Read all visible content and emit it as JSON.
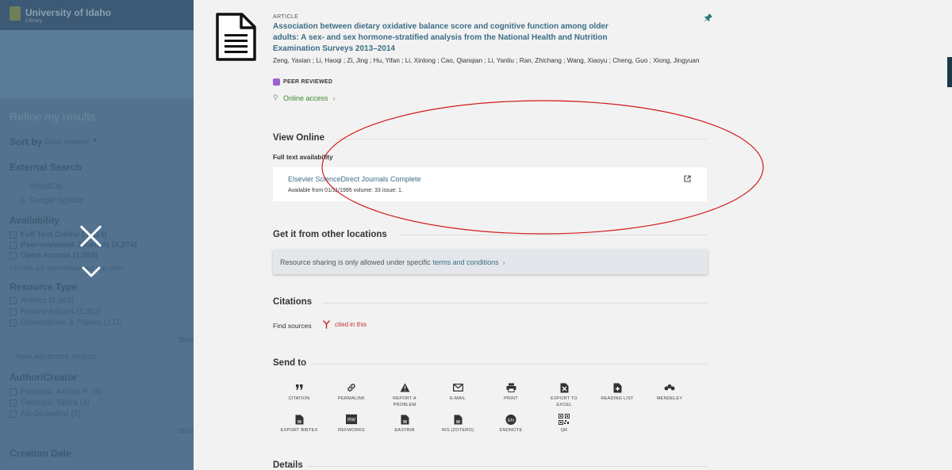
{
  "background": {
    "logo": "University of Idaho",
    "logo_sub": "Library",
    "refine_heading": "Refine my results",
    "sort_by": "Sort by",
    "sort_value": "Date newest",
    "external_search": "External Search",
    "ext_items": [
      "WorldCat",
      "Google Scholar"
    ],
    "availability": "Availability",
    "avail_items": [
      "Full Text Online (3,614)",
      "Peer-reviewed Journals (4,274)",
      "Open Access (1,089)"
    ],
    "avail_note": "* Counts are approximate and may differ",
    "resource_type": "Resource Type",
    "type_items": [
      "Articles (5,461)",
      "Review Articles (1,302)",
      "Dissertations & Theses (171)"
    ],
    "show_more": "Show more",
    "new_search": "New Advanced Search",
    "author_creator": "Author/Creator",
    "author_items": [
      "Farooqui, Akhlaq R. (4)",
      "Farooqui, Tahira (4)",
      "Alli-Oluwafuyi (2)"
    ],
    "creation_date": "Creation Date"
  },
  "article": {
    "type": "Article",
    "title": "Association between dietary oxidative balance score and cognitive function among older adults: A sex- and sex hormone-stratified analysis from the National Health and Nutrition Examination Surveys 2013–2014",
    "authors": "Zeng, Yaxian ; Li, Haoqi ; Zi, Jing ; Hu, Yifan ; Li, Xinlong ; Cao, Qianqian ; Li, Yanliu ; Ran, Zhichang ; Wang, Xiaoyu ; Cheng, Guo ; Xiong, Jingyuan",
    "peer_reviewed": "Peer Reviewed",
    "online_access": "Online access"
  },
  "view_online": {
    "heading": "View Online",
    "fulltext_label": "Full text availability",
    "service_name": "Elsevier ScienceDirect Journals Complete",
    "service_avail": "Available from 01/11/1995 volume: 33 issue: 1."
  },
  "other_locations": {
    "heading": "Get it from other locations",
    "sharing_text": "Resource sharing is only allowed under specific",
    "sharing_link": "terms and conditions"
  },
  "citations": {
    "heading": "Citations",
    "find_sources": "Find sources",
    "cited_in_this": "cited in this"
  },
  "send_to": {
    "heading": "Send to",
    "items": [
      {
        "label": "Citation",
        "icon": "quote-icon"
      },
      {
        "label": "Permalink",
        "icon": "link-icon"
      },
      {
        "label": "Report a problem",
        "icon": "warning-icon"
      },
      {
        "label": "E-mail",
        "icon": "email-icon"
      },
      {
        "label": "Print",
        "icon": "print-icon"
      },
      {
        "label": "Export to Excel",
        "icon": "excel-icon"
      },
      {
        "label": "Reading list",
        "icon": "reading-list-icon"
      },
      {
        "label": "Mendeley",
        "icon": "mendeley-icon"
      },
      {
        "label": "Export BibTeX",
        "icon": "bibtex-icon"
      },
      {
        "label": "RefWorks",
        "icon": "refworks-icon"
      },
      {
        "label": "EasyBib",
        "icon": "easybib-icon"
      },
      {
        "label": "RIS (Zotero)",
        "icon": "ris-icon"
      },
      {
        "label": "EndNote",
        "icon": "endnote-icon"
      },
      {
        "label": "QR",
        "icon": "qr-icon"
      }
    ]
  },
  "details": {
    "heading": "Details"
  },
  "colors": {
    "title_link": "#3b6e86",
    "online_green": "#3c8a2e",
    "cited_red": "#c5312b",
    "annotation": "#d11a1a",
    "overlay": "#52728f"
  }
}
